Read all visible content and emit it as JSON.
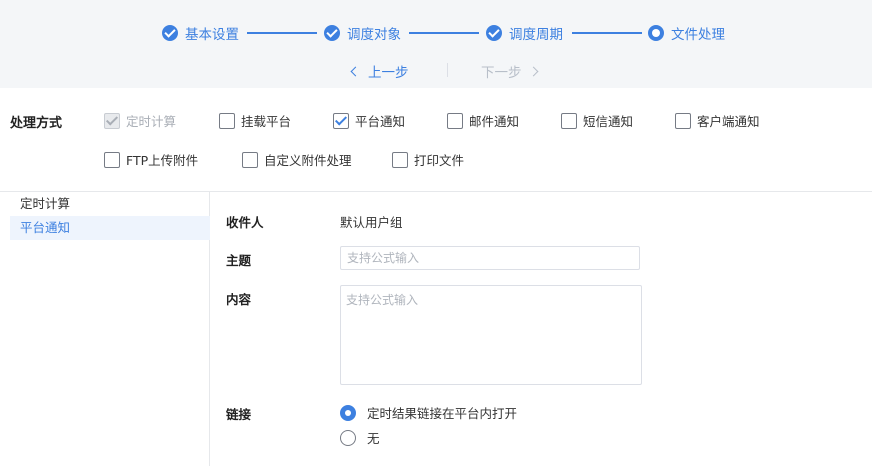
{
  "steps": [
    {
      "label": "基本设置",
      "state": "done",
      "icon": "check-circle-icon"
    },
    {
      "label": "调度对象",
      "state": "done",
      "icon": "check-circle-icon"
    },
    {
      "label": "调度周期",
      "state": "done",
      "icon": "check-circle-icon"
    },
    {
      "label": "文件处理",
      "state": "current",
      "icon": "dot-circle-icon"
    }
  ],
  "nav": {
    "prev_label": "上一步",
    "next_label": "下一步",
    "prev_icon": "chevron-left-icon",
    "next_icon": "chevron-right-icon"
  },
  "method": {
    "label": "处理方式",
    "options": [
      {
        "label": "定时计算",
        "checked": true,
        "disabled": true
      },
      {
        "label": "挂载平台",
        "checked": false,
        "disabled": false
      },
      {
        "label": "平台通知",
        "checked": true,
        "disabled": false
      },
      {
        "label": "邮件通知",
        "checked": false,
        "disabled": false
      },
      {
        "label": "短信通知",
        "checked": false,
        "disabled": false
      },
      {
        "label": "客户端通知",
        "checked": false,
        "disabled": false
      },
      {
        "label": "FTP上传附件",
        "checked": false,
        "disabled": false
      },
      {
        "label": "自定义附件处理",
        "checked": false,
        "disabled": false
      },
      {
        "label": "打印文件",
        "checked": false,
        "disabled": false
      }
    ]
  },
  "sidebar": {
    "items": [
      {
        "label": "定时计算",
        "active": false
      },
      {
        "label": "平台通知",
        "active": true
      }
    ]
  },
  "form": {
    "recipient_label": "收件人",
    "recipient_value": "默认用户组",
    "subject_label": "主题",
    "subject_placeholder": "支持公式输入",
    "content_label": "内容",
    "content_placeholder": "支持公式输入",
    "link_label": "链接",
    "link_options": [
      {
        "label": "定时结果链接在平台内打开",
        "checked": true
      },
      {
        "label": "无",
        "checked": false
      }
    ]
  },
  "colors": {
    "accent": "#3d80e0",
    "header_bg": "#f4f6f8",
    "active_bg": "#eef4fd",
    "disabled": "#a9aeb6"
  }
}
